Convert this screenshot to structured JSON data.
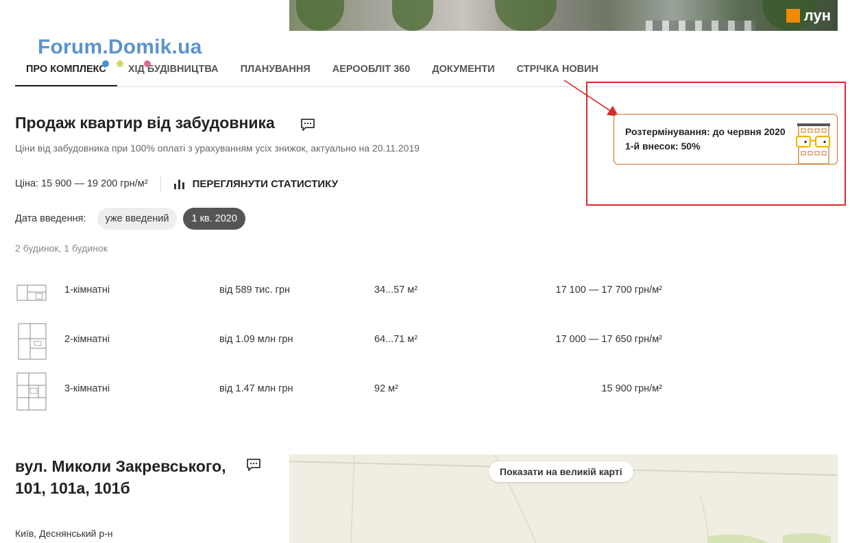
{
  "brand": {
    "logo_text": "лун",
    "accent": "#f08a00"
  },
  "watermark": "Forum.Domik.ua",
  "nav": {
    "tabs": [
      {
        "label": "ПРО КОМПЛЕКС",
        "active": true
      },
      {
        "label": "ХІД БУДІВНИЦТВА",
        "active": false
      },
      {
        "label": "ПЛАНУВАННЯ",
        "active": false
      },
      {
        "label": "АЕРООБЛІТ 360",
        "active": false
      },
      {
        "label": "ДОКУМЕНТИ",
        "active": false
      },
      {
        "label": "СТРІЧКА НОВИН",
        "active": false
      }
    ]
  },
  "sales": {
    "title": "Продаж квартир від забудовника",
    "subtitle": "Ціни від забудовника при 100% оплаті з урахуванням усіх знижок, актуально на 20.11.2019",
    "price": "Ціна: 15 900 — 19 200 грн/м²",
    "stats_link": "ПЕРЕГЛЯНУТИ СТАТИСТИКУ",
    "date_label": "Дата введення:",
    "date_chips": [
      {
        "label": "уже введений",
        "selected": false
      },
      {
        "label": "1 кв. 2020",
        "selected": true
      }
    ],
    "houses": "2 будинок, 1 будинок",
    "rows": [
      {
        "rooms": "1-кімнатні",
        "price_from": "від 589 тис. грн",
        "area": "34...57 м²",
        "price_m2": "17 100 — 17 700 грн/м²"
      },
      {
        "rooms": "2-кімнатні",
        "price_from": "від 1.09 млн грн",
        "area": "64...71 м²",
        "price_m2": "17 000 — 17 650 грн/м²"
      },
      {
        "rooms": "3-кімнатні",
        "price_from": "від 1.47 млн грн",
        "area": "92 м²",
        "price_m2": "15 900 грн/м²"
      }
    ]
  },
  "promo": {
    "line1": "Розтермінування: до червня 2020",
    "line2": "1-й внесок: 50%",
    "highlight_color": "#d42c2c"
  },
  "location": {
    "address": "вул. Миколи Закревського, 101, 101а, 101б",
    "city": "Київ, Деснянський р-н",
    "map_button": "Показати на великій карті"
  }
}
